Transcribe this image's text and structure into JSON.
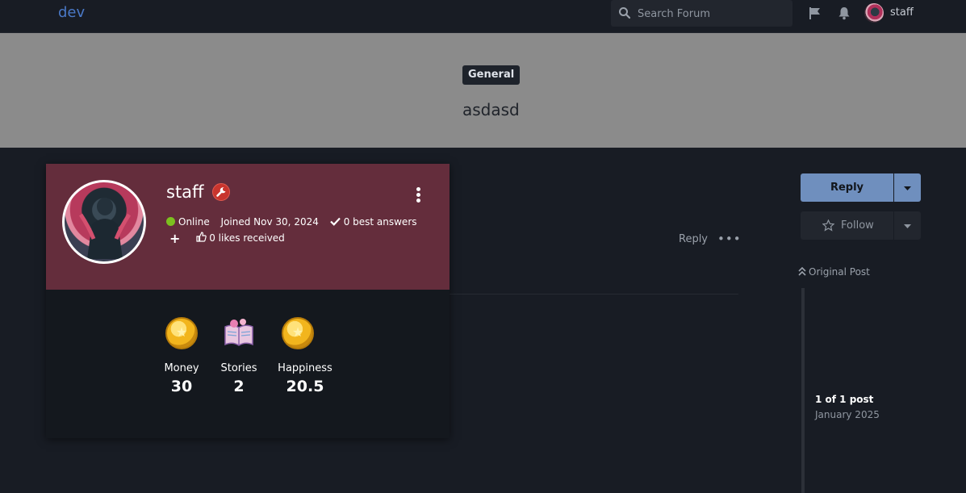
{
  "nav": {
    "brand": "dev",
    "search_placeholder": "Search Forum",
    "username": "staff"
  },
  "topic": {
    "category": "General",
    "title": "asdasd"
  },
  "post": {
    "reply_label": "Reply",
    "more_label": "•••"
  },
  "profile": {
    "name": "staff",
    "status": "Online",
    "joined": "Joined Nov 30, 2024",
    "best_answers": "0 best answers",
    "likes": "0 likes received",
    "stats": [
      {
        "label": "Money",
        "value": "30",
        "icon": "coin-icon"
      },
      {
        "label": "Stories",
        "value": "2",
        "icon": "book-icon"
      },
      {
        "label": "Happiness",
        "value": "20.5",
        "icon": "coin-icon"
      }
    ]
  },
  "sidebar": {
    "reply_label": "Reply",
    "follow_label": "Follow",
    "original_post_label": "Original Post",
    "timeline_count": "1 of 1 post",
    "timeline_date": "January 2025"
  },
  "colors": {
    "brand": "#4a79c7",
    "card_header": "#642d3c",
    "reply_button": "#6f8fbe",
    "online_dot": "#7cc01f"
  }
}
